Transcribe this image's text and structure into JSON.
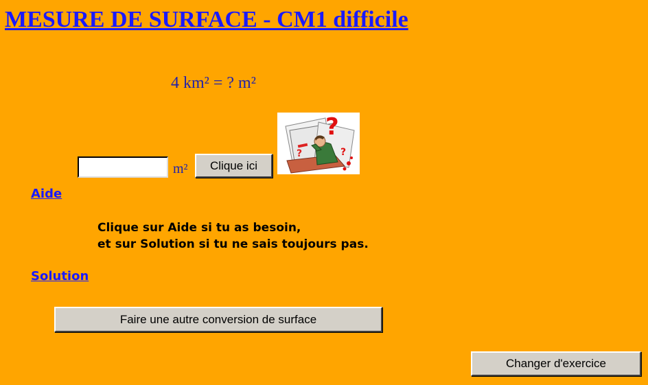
{
  "page": {
    "title": "MESURE DE SURFACE - CM1 difficile"
  },
  "exercise": {
    "question": "4 km² = ? m²",
    "input_value": "",
    "unit": "m²",
    "check_button": "Clique ici"
  },
  "links": {
    "help": "Aide",
    "solution": "Solution"
  },
  "hint": {
    "line1": "Clique sur Aide si tu as besoin,",
    "line2": "et sur Solution si tu ne sais toujours pas."
  },
  "buttons": {
    "another": "Faire une autre conversion de surface",
    "change": "Changer d'exercice"
  },
  "icons": {
    "illustration": "thinking-man-question-marks-icon"
  },
  "colors": {
    "background": "#FFA500",
    "title": "#1a1aff",
    "question": "#2222aa",
    "button_face": "#d4d0c8"
  }
}
